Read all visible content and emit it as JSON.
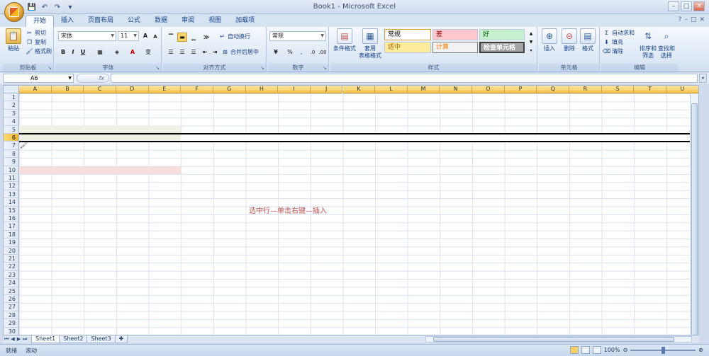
{
  "window": {
    "title": "Book1 - Microsoft Excel"
  },
  "qat": {
    "icons": [
      "save-icon",
      "undo-icon",
      "redo-icon",
      "customize-qat-icon"
    ]
  },
  "window_controls": {
    "minimize": "–",
    "maximize": "□",
    "close": "✕"
  },
  "tabs": [
    "开始",
    "插入",
    "页面布局",
    "公式",
    "数据",
    "审阅",
    "视图",
    "加载项"
  ],
  "active_tab": "开始",
  "ribbon_controls": {
    "help": "?",
    "minimize": "–",
    "restore": "□",
    "close": "✕"
  },
  "clipboard": {
    "paste": "粘贴",
    "cut": "剪切",
    "copy": "复制",
    "format_painter": "格式刷",
    "label": "剪贴板"
  },
  "font": {
    "name": "宋体",
    "size": "11",
    "grow": "A",
    "shrink": "A",
    "bold": "B",
    "italic": "I",
    "underline": "U",
    "wen": "变",
    "label": "字体"
  },
  "alignment": {
    "wrap": "自动换行",
    "merge": "合并后居中",
    "label": "对齐方式"
  },
  "number": {
    "format": "常规",
    "percent": "%",
    "comma": ",",
    "inc_dec": ".0",
    "label": "数字"
  },
  "styles": {
    "conditional": "条件格式",
    "table_format": "套用\n表格格式",
    "cells": [
      "常规",
      "差",
      "好",
      "适中",
      "计算",
      "检查单元格"
    ],
    "label": "样式"
  },
  "cells_group": {
    "insert": "插入",
    "delete": "删除",
    "format": "格式",
    "label": "单元格"
  },
  "editing": {
    "autosum": "自动求和",
    "fill": "填充",
    "clear": "清除",
    "sort": "排序和\n筛选",
    "find": "查找和\n选择",
    "label": "编辑"
  },
  "formula_bar": {
    "name_box": "A6",
    "fx": "fx",
    "value": ""
  },
  "columns": [
    "A",
    "B",
    "C",
    "D",
    "E",
    "F",
    "G",
    "H",
    "I",
    "J",
    "K",
    "L",
    "M",
    "N",
    "O",
    "P",
    "Q",
    "R",
    "S",
    "T",
    "U"
  ],
  "rows": [
    "1",
    "2",
    "3",
    "4",
    "5",
    "6",
    "7",
    "8",
    "9",
    "10",
    "11",
    "12",
    "13",
    "14",
    "15",
    "16",
    "17",
    "18",
    "19",
    "20",
    "21",
    "22",
    "23",
    "24",
    "25",
    "26",
    "27",
    "28",
    "29",
    "30"
  ],
  "selected_row": "6",
  "annotation": "选中行—单击右键—插入",
  "sheets": [
    "Sheet1",
    "Sheet2",
    "Sheet3"
  ],
  "active_sheet": "Sheet1",
  "status": {
    "ready": "就绪",
    "scroll": "滚动",
    "zoom": "100%"
  },
  "colors": {
    "accent": "#f5c44d",
    "highlight_row5": "#eef1e3",
    "highlight_row10": "#f7dddd",
    "annotation": "#c0504d"
  }
}
